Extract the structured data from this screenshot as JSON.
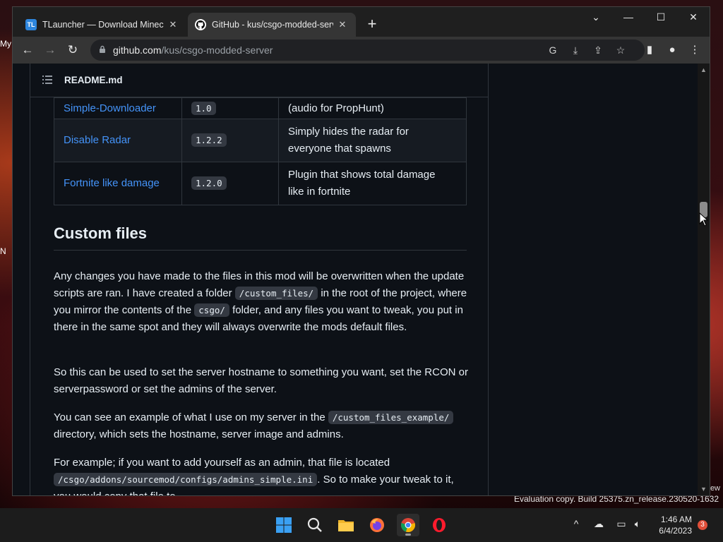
{
  "desktop": {
    "side_label_1": "My",
    "side_label_2": "N",
    "eval_text": "Evaluation copy. Build 25375.zn_release.230520-1632",
    "eval_partial": "ew"
  },
  "tabs": [
    {
      "title": "TLauncher — Download Minecraft",
      "favicon": "TL"
    },
    {
      "title": "GitHub - kus/csgo-modded-server",
      "favicon": "github-icon"
    }
  ],
  "address": {
    "domain": "github.com",
    "path": "/kus/csgo-modded-server"
  },
  "sticky_header": {
    "label": "README.md"
  },
  "table": {
    "rows": [
      {
        "name": "Simple-Downloader",
        "version": "1.0",
        "desc_lines": [
          "",
          "(audio for PropHunt)"
        ]
      },
      {
        "name": "Disable Radar",
        "version": "1.2.2",
        "desc_lines": [
          "Simply hides the radar for",
          "everyone that spawns"
        ]
      },
      {
        "name": "Fortnite like damage",
        "version": "1.2.0",
        "desc_lines": [
          "Plugin that shows total damage",
          "like in fortnite"
        ]
      }
    ]
  },
  "section": {
    "heading": "Custom files",
    "p1": {
      "a": "Any changes you have made to the files in this mod will be overwritten when the update scripts are ran. I have created a folder ",
      "code1": "/custom_files/",
      "b": " in the root of the project, where you mirror the contents of the ",
      "code2": "csgo/",
      "c": " folder, and any files you want to tweak, you put in there in the same spot and they will always overwrite the mods default files."
    },
    "p2": "So this can be used to set the server hostname to something you want, set the RCON or serverpassword or set the admins of the server.",
    "p3": {
      "a": "You can see an example of what I use on my server in the ",
      "code": "/custom_files_example/",
      "b": " directory, which sets the hostname, server image and admins."
    },
    "p4": {
      "a": "For example; if you want to add yourself as an admin, that file is located ",
      "code": "/csgo/addons/sourcemod/configs/admins_simple.ini",
      "b": ". So to make your tweak to it, you would copy that file to"
    }
  },
  "taskbar": {
    "apps": [
      "windows-start",
      "search",
      "file-explorer",
      "firefox",
      "chrome",
      "opera"
    ],
    "time": "1:46 AM",
    "date": "6/4/2023",
    "notifications": "3"
  },
  "colors": {
    "link": "#4493f8",
    "bg": "#0d1117",
    "border": "#30363d"
  }
}
